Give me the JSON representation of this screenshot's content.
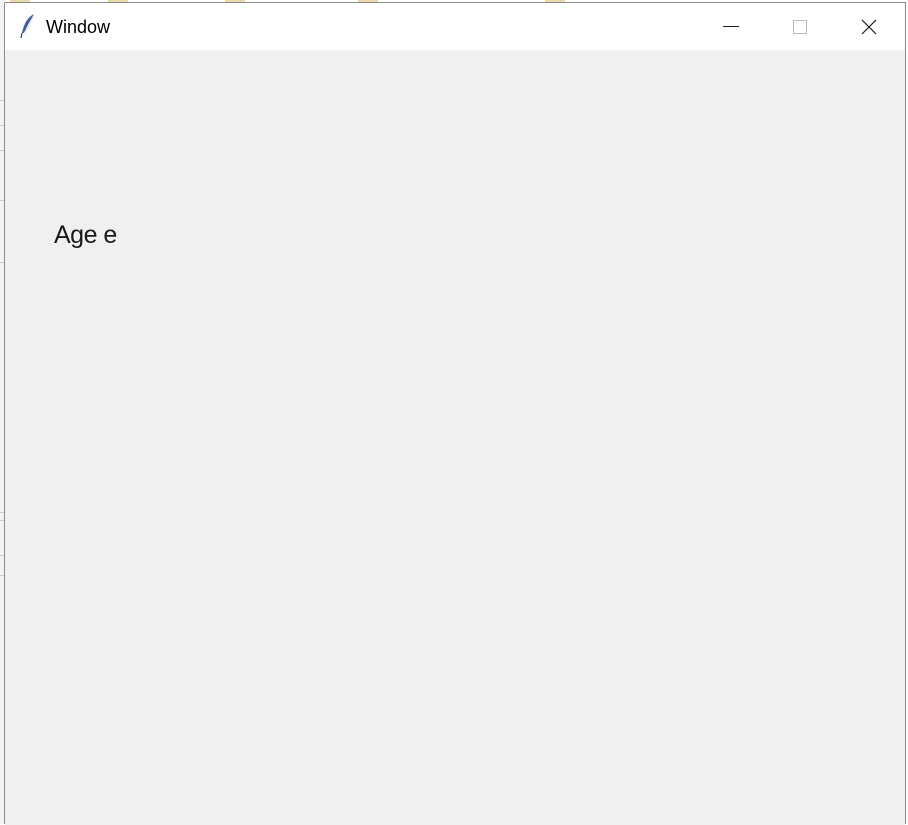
{
  "window": {
    "title": "Window",
    "icon": "tk-feather-icon"
  },
  "controls": {
    "minimize": "minimize-icon",
    "maximize": "maximize-icon",
    "close": "close-icon"
  },
  "content": {
    "label_text": "Age e"
  },
  "colors": {
    "titlebar_bg": "#ffffff",
    "client_bg": "#f0f0f0",
    "text": "#1a1a1a"
  }
}
